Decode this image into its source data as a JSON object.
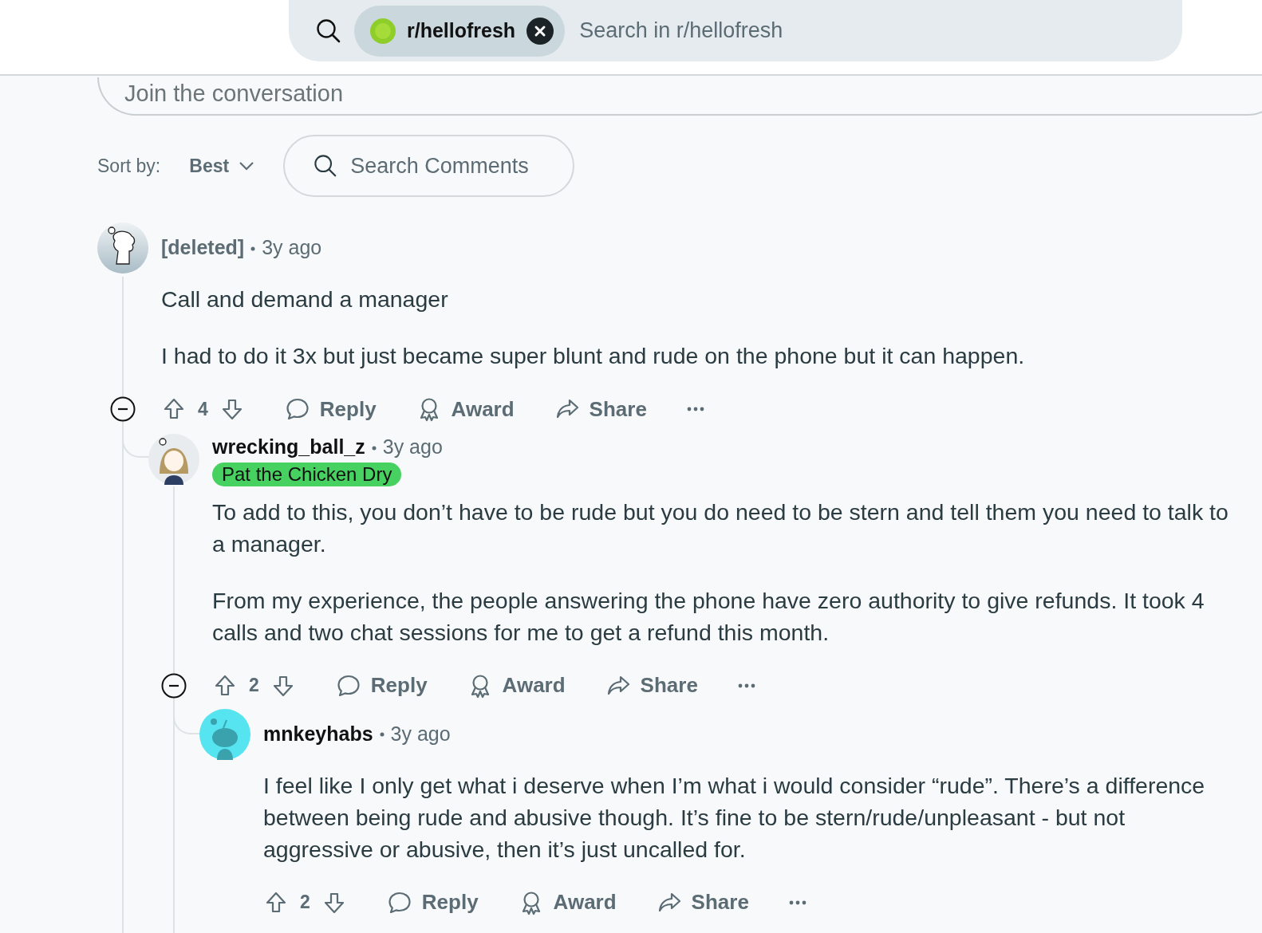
{
  "search": {
    "community": "r/hellofresh",
    "placeholder": "Search in r/hellofresh"
  },
  "composer": {
    "placeholder": "Join the conversation"
  },
  "sort": {
    "label": "Sort by:",
    "value": "Best"
  },
  "comment_search": {
    "placeholder": "Search Comments"
  },
  "comments": [
    {
      "author": "[deleted]",
      "deleted": true,
      "avatar": {
        "kind": "deleted"
      },
      "time": "3y ago",
      "paragraphs": [
        "Call and demand a manager",
        "I had to do it 3x but just became super blunt and rude on the phone but it can happen."
      ],
      "votes": "4",
      "actions": [
        "Reply",
        "Award",
        "Share"
      ],
      "children": [
        {
          "author": "wrecking_ball_z",
          "deleted": false,
          "avatar": {
            "kind": "character"
          },
          "time": "3y ago",
          "flair": "Pat the Chicken Dry",
          "paragraphs": [
            "To add to this, you don’t have to be rude but you do need to be stern and tell them you need to talk to a manager.",
            "From my experience, the people answering the phone have zero authority to give refunds. It took 4 calls and two chat sessions for me to get a refund this month."
          ],
          "votes": "2",
          "actions": [
            "Reply",
            "Award",
            "Share"
          ],
          "children": [
            {
              "author": "mnkeyhabs",
              "deleted": false,
              "avatar": {
                "kind": "snoo"
              },
              "time": "3y ago",
              "paragraphs": [
                "I feel like I only get what i deserve when I’m what i would consider “rude”. There’s a difference between being rude and abusive though. It’s fine to be stern/rude/unpleasant - but not aggressive or abusive, then it’s just uncalled for."
              ],
              "votes": "2",
              "actions": [
                "Reply",
                "Award",
                "Share"
              ]
            }
          ]
        }
      ]
    }
  ]
}
